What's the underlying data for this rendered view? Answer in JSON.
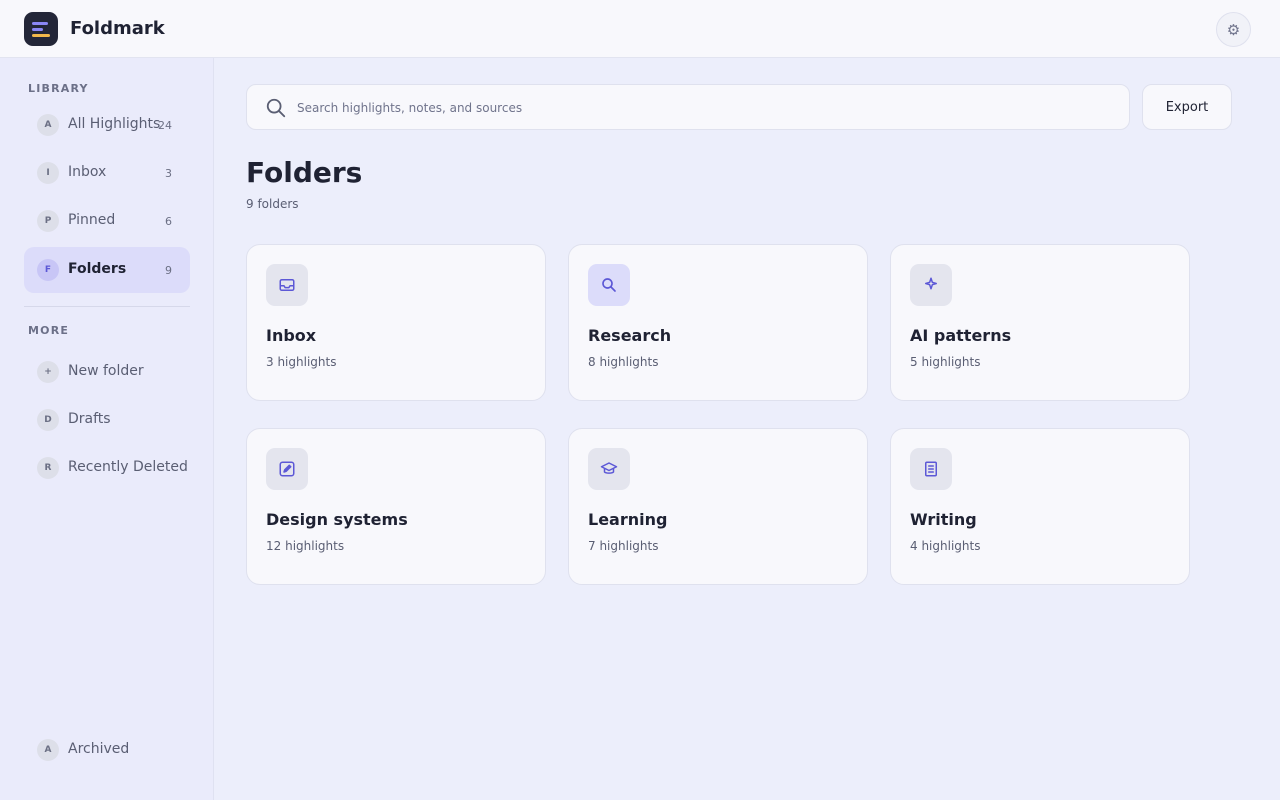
{
  "app": {
    "title": "Foldmark"
  },
  "header": {
    "settings_icon": "gear-icon"
  },
  "sidebar": {
    "library_label": "LIBRARY",
    "library_items": [
      {
        "badge": "A",
        "label": "All Highlights",
        "count": "24",
        "active": false
      },
      {
        "badge": "I",
        "label": "Inbox",
        "count": "3",
        "active": false
      },
      {
        "badge": "P",
        "label": "Pinned",
        "count": "6",
        "active": false
      },
      {
        "badge": "F",
        "label": "Folders",
        "count": "9",
        "active": true
      }
    ],
    "more_label": "MORE",
    "more_items": [
      {
        "badge": "+",
        "label": "New folder"
      },
      {
        "badge": "D",
        "label": "Drafts"
      },
      {
        "badge": "R",
        "label": "Recently Deleted"
      }
    ],
    "footer_item": {
      "badge": "A",
      "label": "Archived"
    }
  },
  "search": {
    "placeholder": "Search highlights, notes, and sources",
    "value": ""
  },
  "toolbar": {
    "export_label": "Export"
  },
  "main": {
    "title": "Folders",
    "subtitle": "9 folders",
    "folders": [
      {
        "name": "Inbox",
        "count": "3 highlights",
        "icon": "inbox-icon"
      },
      {
        "name": "Research",
        "count": "8 highlights",
        "icon": "search-icon"
      },
      {
        "name": "AI patterns",
        "count": "5 highlights",
        "icon": "sparkle-icon"
      },
      {
        "name": "Design systems",
        "count": "12 highlights",
        "icon": "edit-icon"
      },
      {
        "name": "Learning",
        "count": "7 highlights",
        "icon": "graduation-cap-icon"
      },
      {
        "name": "Writing",
        "count": "4 highlights",
        "icon": "document-icon"
      }
    ]
  },
  "colors": {
    "accent": "#5c58d6",
    "active_nav_bg": "#dcdcfa",
    "background": "#eceefb",
    "card_bg": "#f8f8fc"
  }
}
